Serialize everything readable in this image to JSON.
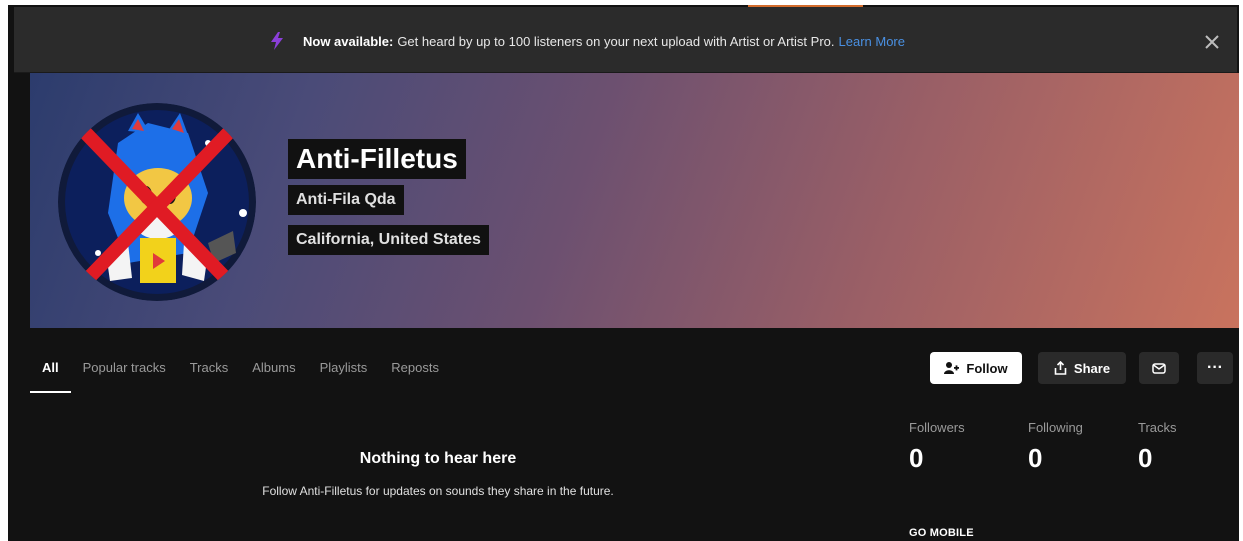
{
  "banner": {
    "strong": "Now available:",
    "text": "Get heard by up to 100 listeners on your next upload with Artist or Artist Pro.",
    "link": "Learn More",
    "icon": "bolt-icon",
    "close_icon": "close-icon"
  },
  "profile": {
    "name": "Anti-Filletus",
    "subtitle": "Anti-Fila Qda",
    "location": "California, United States"
  },
  "tabs": [
    "All",
    "Popular tracks",
    "Tracks",
    "Albums",
    "Playlists",
    "Reposts"
  ],
  "actions": {
    "follow": "Follow",
    "share": "Share",
    "message_icon": "mail-icon",
    "more": "···"
  },
  "empty": {
    "title": "Nothing to hear here",
    "text": "Follow Anti-Filletus for updates on sounds they share in the future."
  },
  "stats": [
    {
      "label": "Followers",
      "value": "0"
    },
    {
      "label": "Following",
      "value": "0"
    },
    {
      "label": "Tracks",
      "value": "0"
    }
  ],
  "sidebar": {
    "go_mobile": "GO MOBILE"
  },
  "colors": {
    "accent": "#d36c2c",
    "link": "#4a90e2",
    "banner_bg": "#2b2b2b",
    "page_bg": "#121212",
    "hero_gradient_start": "#2c3c6d",
    "hero_gradient_end": "#c9735e"
  }
}
